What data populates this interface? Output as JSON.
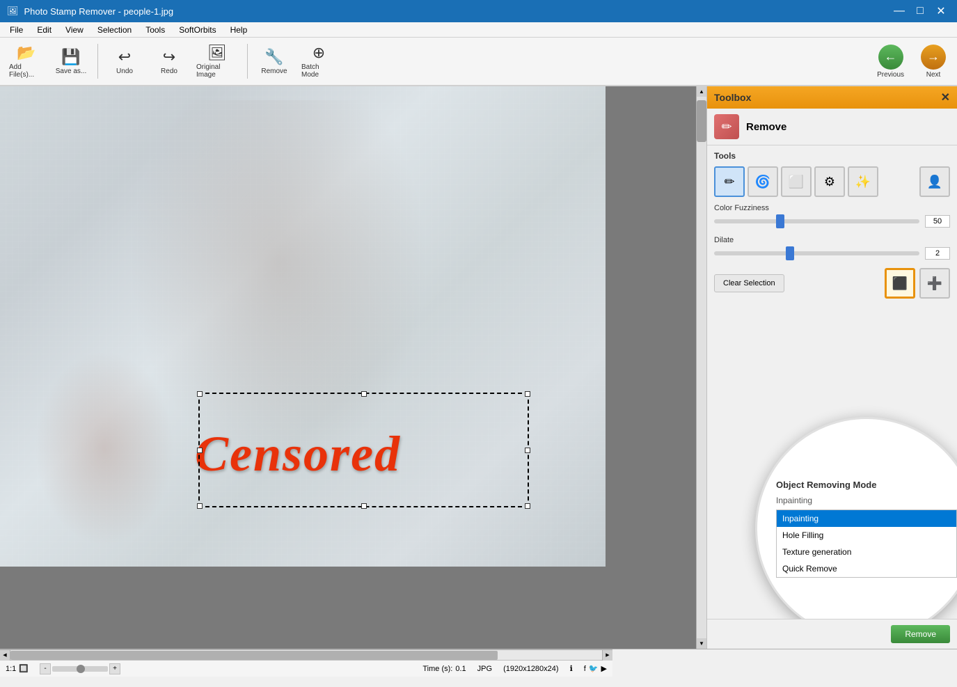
{
  "titlebar": {
    "icon": "🖼",
    "title": "Photo Stamp Remover - people-1.jpg",
    "minimize": "—",
    "maximize": "□",
    "close": "✕"
  },
  "menubar": {
    "items": [
      "File",
      "Edit",
      "View",
      "Selection",
      "Tools",
      "SoftOrbits",
      "Help"
    ]
  },
  "toolbar": {
    "add_files_label": "Add File(s)...",
    "save_as_label": "Save as...",
    "undo_label": "Undo",
    "redo_label": "Redo",
    "original_image_label": "Original Image",
    "remove_label": "Remove",
    "batch_mode_label": "Batch Mode",
    "previous_label": "Previous",
    "next_label": "Next"
  },
  "toolbox": {
    "title": "Toolbox",
    "close_btn": "✕",
    "remove_section": {
      "label": "Remove"
    },
    "tools_label": "Tools",
    "color_fuzziness_label": "Color Fuzziness",
    "color_fuzziness_value": "50",
    "color_fuzziness_pct": 30,
    "dilate_label": "Dilate",
    "dilate_value": "2",
    "dilate_pct": 35,
    "clear_selection_btn": "Clear Selection",
    "object_removing_mode_label": "Object Removing Mode",
    "mode_current": "Inpainting",
    "mode_options": [
      "Inpainting",
      "Hole Filling",
      "Texture generation",
      "Quick Remove"
    ],
    "mode_selected_index": 0,
    "remove_btn": "Remove"
  },
  "canvas": {
    "censored_text": "Censored"
  },
  "statusbar": {
    "time_label": "Time (s):",
    "time_value": "0.1",
    "format": "JPG",
    "dimensions": "(1920x1280x24)",
    "zoom": "1:1"
  }
}
